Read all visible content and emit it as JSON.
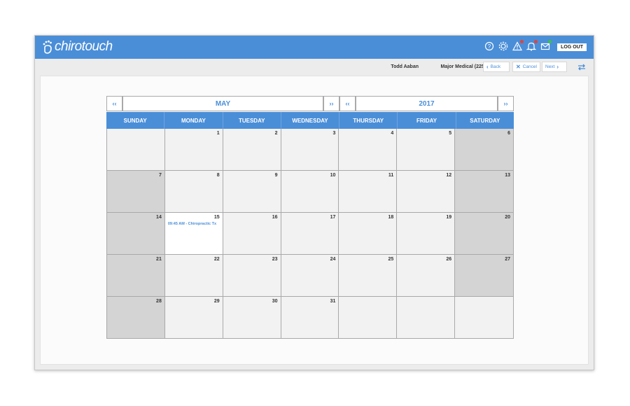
{
  "app": {
    "brand": "chirotouch",
    "logout_label": "LOG OUT",
    "accent": "#4a8ed8"
  },
  "toolbar_icons": [
    {
      "name": "help-icon",
      "dot": null
    },
    {
      "name": "gear-icon",
      "dot": null
    },
    {
      "name": "warning-icon",
      "dot": "#e0443c"
    },
    {
      "name": "bell-icon",
      "dot": "#e0443c"
    },
    {
      "name": "mail-icon",
      "dot": "#3cc24a"
    }
  ],
  "subbar": {
    "patient_name": "Todd Aaban",
    "insurance": "Major Medical (2259)",
    "back_label": "Back",
    "cancel_label": "Cancel",
    "next_label": "Next"
  },
  "calendar": {
    "month": "MAY",
    "year": "2017",
    "prev_glyph": "‹‹",
    "next_glyph": "››",
    "weekdays": [
      "SUNDAY",
      "MONDAY",
      "TUESDAY",
      "WEDNESDAY",
      "THURSDAY",
      "FRIDAY",
      "SATURDAY"
    ],
    "weeks": [
      [
        "",
        "1",
        "2",
        "3",
        "4",
        "5",
        "6"
      ],
      [
        "7",
        "8",
        "9",
        "10",
        "11",
        "12",
        "13"
      ],
      [
        "14",
        "15",
        "16",
        "17",
        "18",
        "19",
        "20"
      ],
      [
        "21",
        "22",
        "23",
        "24",
        "25",
        "26",
        "27"
      ],
      [
        "28",
        "29",
        "30",
        "31",
        "",
        "",
        ""
      ]
    ],
    "appointments": [
      {
        "day": "15",
        "text": "09:45 AM - Chiropractic Tx"
      }
    ]
  }
}
